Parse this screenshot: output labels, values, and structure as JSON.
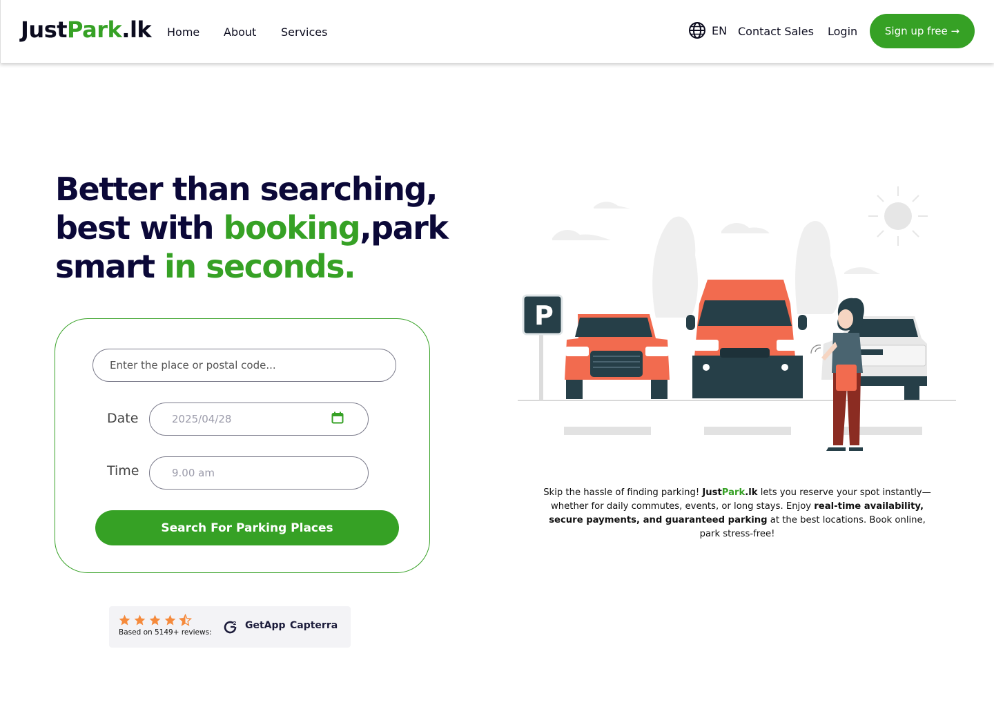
{
  "header": {
    "logo": {
      "part1": "Just",
      "part2": "Park",
      "part3": ".lk"
    },
    "nav": {
      "home": "Home",
      "about": "About",
      "services": "Services"
    },
    "language": "EN",
    "contact_sales": "Contact Sales",
    "login": "Login",
    "signup": "Sign up free →"
  },
  "hero": {
    "line1": "Better than searching,",
    "line2a": "best with ",
    "line2b": "booking",
    "line2c": ",park",
    "line3a": "smart ",
    "line3b": "in seconds."
  },
  "search": {
    "place_placeholder": "Enter the place or postal code...",
    "date_label": "Date",
    "date_value": "2025/04/28",
    "time_label": "Time",
    "time_placeholder": "9.00 am",
    "button": "Search For Parking Places"
  },
  "reviews": {
    "rating": 4.5,
    "text": "Based on 5149+ reviews:",
    "getapp": "GetApp",
    "capterra": "Capterra"
  },
  "description": {
    "p1": "Skip the hassle of finding parking! ",
    "brand_a": "Just",
    "brand_b": "Park",
    "brand_c": ".lk",
    "p2": " lets you reserve your spot instantly—whether for daily commutes, events, or long stays. Enjoy ",
    "bold1": "real-time availability, secure payments, and guaranteed parking",
    "p3": " at the best locations. Book online, park stress-free!"
  },
  "colors": {
    "accent": "#36a125",
    "heading": "#0b0838",
    "car": "#f26b4f"
  },
  "illustration": {
    "sign_letter": "P"
  }
}
